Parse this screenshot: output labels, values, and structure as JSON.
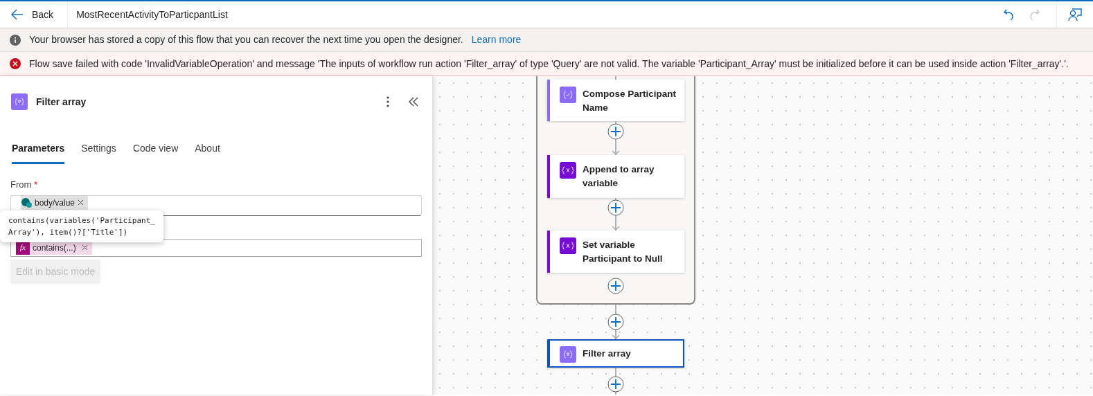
{
  "header": {
    "back": "Back",
    "title": "MostRecentActivityToParticpantList"
  },
  "info_bar": {
    "message": "Your browser has stored a copy of this flow that you can recover the next time you open the designer.",
    "link": "Learn more"
  },
  "error_bar": {
    "message": "Flow save failed with code 'InvalidVariableOperation' and message 'The inputs of workflow run action 'Filter_array' of type 'Query' are not valid. The variable 'Participant_Array' must be initialized before it can be used inside action 'Filter_array'.'."
  },
  "panel": {
    "title": "Filter array",
    "tabs": [
      {
        "label": "Parameters",
        "selected": true
      },
      {
        "label": "Settings",
        "selected": false
      },
      {
        "label": "Code view",
        "selected": false
      },
      {
        "label": "About",
        "selected": false
      }
    ],
    "from_label": "From",
    "required_mark": "*",
    "from_token": "body/value",
    "tooltip": "contains(variables('Participant_\nArray'), item()?['Title'])",
    "query_icon": "fx",
    "query_token": "contains(...)",
    "basic_mode_button": {
      "label": "Edit in basic mode",
      "disabled": true
    }
  },
  "canvas": {
    "scope_nodes": [
      {
        "title": "Compose Participant Name",
        "kind": "compose",
        "selected": false
      },
      {
        "title": "Append to array variable",
        "kind": "variable",
        "selected": false
      },
      {
        "title": "Set variable Participant to Null",
        "kind": "variable",
        "selected": false
      }
    ],
    "nodes": [
      {
        "title": "Filter array",
        "kind": "filter",
        "selected": true
      }
    ]
  }
}
